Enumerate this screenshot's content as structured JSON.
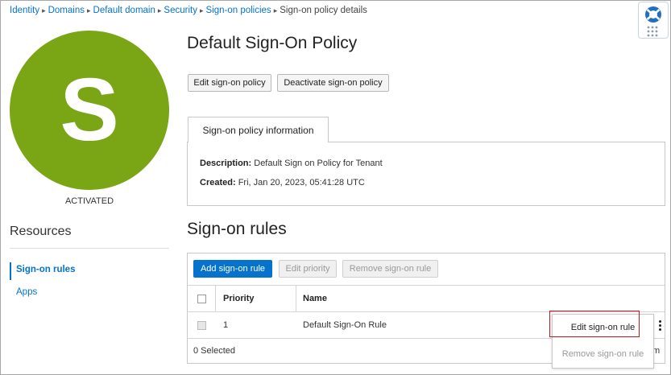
{
  "breadcrumb": {
    "items": [
      "Identity",
      "Domains",
      "Default domain",
      "Security",
      "Sign-on policies"
    ],
    "current": "Sign-on policy details"
  },
  "avatar": {
    "letter": "S",
    "color": "#7aa616",
    "status": "ACTIVATED"
  },
  "resources": {
    "title": "Resources",
    "items": [
      {
        "label": "Sign-on rules",
        "active": true
      },
      {
        "label": "Apps",
        "active": false
      }
    ]
  },
  "page": {
    "title": "Default Sign-On Policy",
    "edit_button": "Edit sign-on policy",
    "deactivate_button": "Deactivate sign-on policy"
  },
  "info": {
    "tab": "Sign-on policy information",
    "description_label": "Description:",
    "description_value": "Default Sign on Policy for Tenant",
    "created_label": "Created:",
    "created_value": "Fri, Jan 20, 2023, 05:41:28 UTC"
  },
  "rules": {
    "title": "Sign-on rules",
    "add_button": "Add sign-on rule",
    "edit_priority_button": "Edit priority",
    "remove_button": "Remove sign-on rule",
    "columns": {
      "priority": "Priority",
      "name": "Name"
    },
    "rows": [
      {
        "priority": "1",
        "name": "Default Sign-On Rule"
      }
    ],
    "selected": "0 Selected",
    "menu": {
      "edit": "Edit sign-on rule",
      "remove": "Remove sign-on rule"
    },
    "peek_text": "m"
  },
  "icons": {
    "help": "lifebuoy-icon",
    "apps": "grid-dots-icon",
    "actions": "kebab-icon"
  },
  "colors": {
    "accent": "#0572ce",
    "highlight": "#c0171b"
  }
}
